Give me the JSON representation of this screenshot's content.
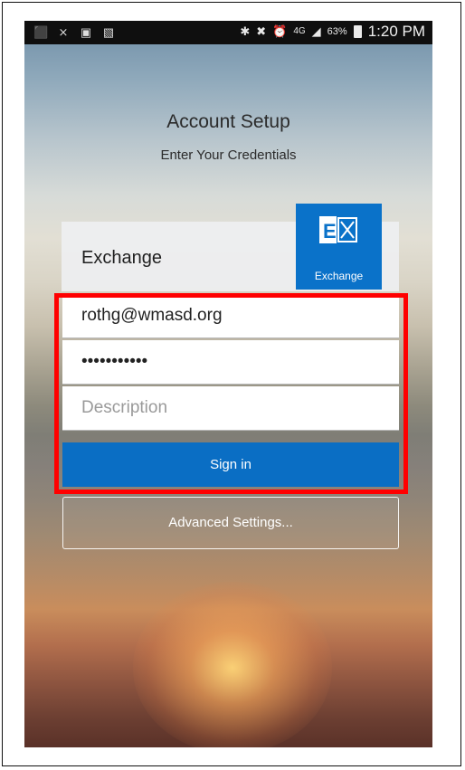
{
  "status_bar": {
    "time": "1:20 PM",
    "battery_percent": "63%",
    "network": "4G",
    "left_icons": [
      "plus-notification-icon",
      "missed-call-icon",
      "gallery-icon",
      "screenshot-icon"
    ],
    "right_icons": [
      "bluetooth-icon",
      "mute-icon",
      "alarm-icon",
      "signal-icon",
      "battery-icon"
    ]
  },
  "header": {
    "title": "Account Setup",
    "subtitle": "Enter Your Credentials"
  },
  "account": {
    "provider_name": "Exchange",
    "logo_label": "Exchange",
    "logo_color": "#0a72c9"
  },
  "form": {
    "email_value": "rothg@wmasd.org",
    "password_value": "•••••••••••",
    "description_placeholder": "Description",
    "sign_in_label": "Sign in",
    "advanced_settings_label": "Advanced Settings...",
    "highlight_color": "#ff0000"
  }
}
